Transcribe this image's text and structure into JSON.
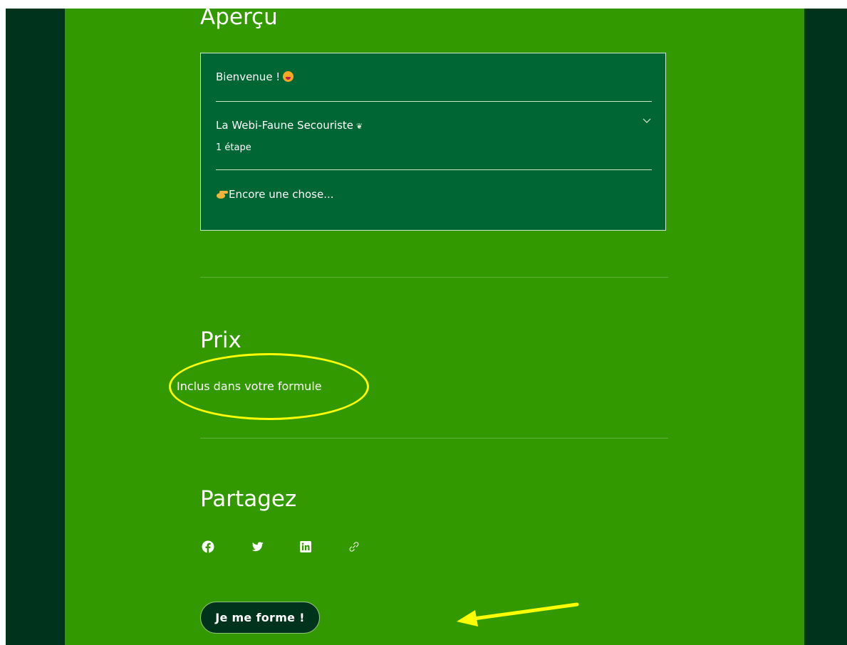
{
  "colors": {
    "outer_background": "#00331c",
    "main_background": "#339900",
    "card_background": "#006633",
    "annotation": "#ffff00"
  },
  "overview": {
    "heading": "Aperçu",
    "rows": [
      {
        "label": "Bienvenue !",
        "icon": "grinning-face-emoji"
      },
      {
        "label": "La Webi-Faune Secouriste",
        "icon": "small-bird-glyph",
        "sub": "1 étape",
        "toggle": "chevron-down-icon"
      },
      {
        "label": "Encore une chose...",
        "icon": "pointing-hand-emoji"
      }
    ]
  },
  "price": {
    "heading": "Prix",
    "text": "Inclus dans votre formule"
  },
  "share": {
    "heading": "Partagez",
    "icons": [
      "facebook-icon",
      "twitter-icon",
      "linkedin-icon",
      "link-icon"
    ]
  },
  "cta": {
    "label": "Je me forme !"
  },
  "annotations": {
    "price_highlight": "yellow-ellipse",
    "cta_pointer": "yellow-arrow"
  }
}
